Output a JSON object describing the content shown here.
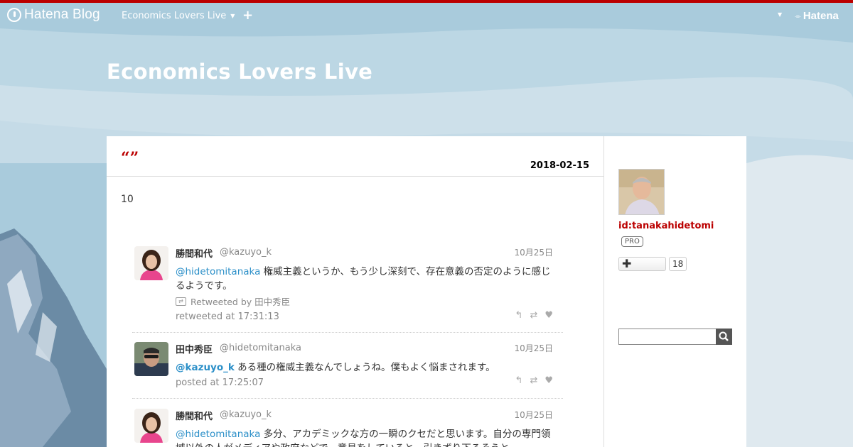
{
  "globalbar": {
    "logo_text": "Hatena Blog",
    "blog_switch_label": "Economics Lovers Live",
    "plus_label": "+",
    "brand_text": "Hatena"
  },
  "blog": {
    "title": "Economics Lovers Live"
  },
  "entry": {
    "title": "“”",
    "date": "2018-02-15",
    "body": "10"
  },
  "tweets": [
    {
      "name": "勝間和代",
      "handle": "@kazuyo_k",
      "date": "10月25日",
      "mention": "@hidetomitanaka",
      "text": " 権威主義というか、もう少し深刻で、存在意義の否定のように感じるようです。",
      "retweeted_by": "Retweeted by 田中秀臣",
      "meta": "retweeted at 17:31:13"
    },
    {
      "name": "田中秀臣",
      "handle": "@hidetomitanaka",
      "date": "10月25日",
      "mention": "@kazuyo_k",
      "text": " ある種の権威主義なんでしょうね。僕もよく悩まされます。",
      "meta": "posted at 17:25:07"
    },
    {
      "name": "勝間和代",
      "handle": "@kazuyo_k",
      "date": "10月25日",
      "mention": "@hidetomitanaka",
      "text": " 多分、アカデミックな方の一瞬のクセだと思います。自分の専門領域以外の人がメディアや政府などで、意見をしていると、引きずり下ろそうと"
    }
  ],
  "actions": {
    "reply": "↰",
    "retweet": "⇄",
    "like": "♥"
  },
  "sidebar": {
    "profile_id": "id:tanakahidetomi",
    "pro_label": "PRO",
    "follow_plus": "✚",
    "follow_count": "18"
  },
  "colors": {
    "accent": "#bb0000",
    "mention": "#2b8fc8"
  }
}
